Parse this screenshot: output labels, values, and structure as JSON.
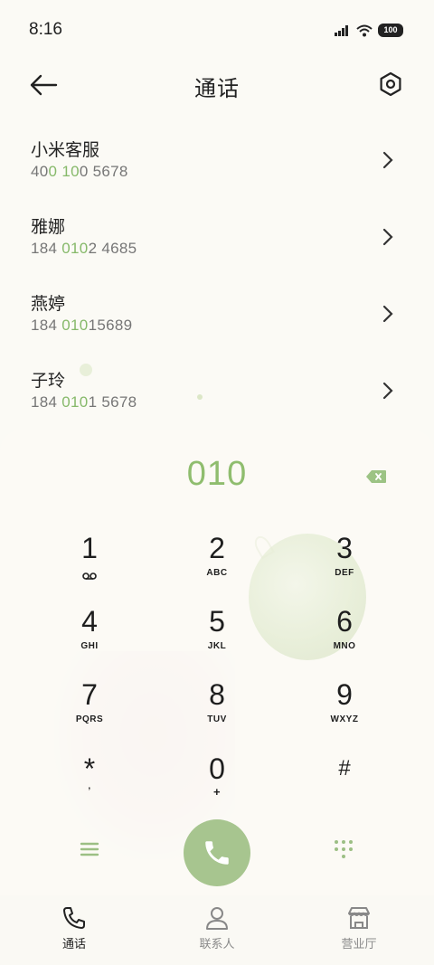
{
  "status": {
    "time": "8:16",
    "battery": "100"
  },
  "header": {
    "title": "通话"
  },
  "contacts": [
    {
      "name": "小米客服",
      "num_a": "40",
      "num_hl1": "0",
      "num_b": " ",
      "num_hl2": "10",
      "num_c": "0 5678"
    },
    {
      "name": "雅娜",
      "num_a": "184 ",
      "num_hl1": "010",
      "num_b": "2 4685",
      "num_hl2": "",
      "num_c": ""
    },
    {
      "name": "燕婷",
      "num_a": "184 ",
      "num_hl1": "010",
      "num_b": "15689",
      "num_hl2": "",
      "num_c": ""
    },
    {
      "name": "子玲",
      "num_a": "184 ",
      "num_hl1": "010",
      "num_b": "1 5678",
      "num_hl2": "",
      "num_c": ""
    }
  ],
  "dialer": {
    "input": "010",
    "keys": [
      {
        "digit": "1",
        "letters": ""
      },
      {
        "digit": "2",
        "letters": "ABC"
      },
      {
        "digit": "3",
        "letters": "DEF"
      },
      {
        "digit": "4",
        "letters": "GHI"
      },
      {
        "digit": "5",
        "letters": "JKL"
      },
      {
        "digit": "6",
        "letters": "MNO"
      },
      {
        "digit": "7",
        "letters": "PQRS"
      },
      {
        "digit": "8",
        "letters": "TUV"
      },
      {
        "digit": "9",
        "letters": "WXYZ"
      },
      {
        "digit": "*",
        "letters": ","
      },
      {
        "digit": "0",
        "letters": "+"
      },
      {
        "digit": "#",
        "letters": ""
      }
    ]
  },
  "nav": [
    {
      "label": "通话"
    },
    {
      "label": "联系人"
    },
    {
      "label": "营业厅"
    }
  ],
  "colors": {
    "accent": "#8fbd6e",
    "call_button": "#a7c58f",
    "background": "#fbfaf5"
  }
}
